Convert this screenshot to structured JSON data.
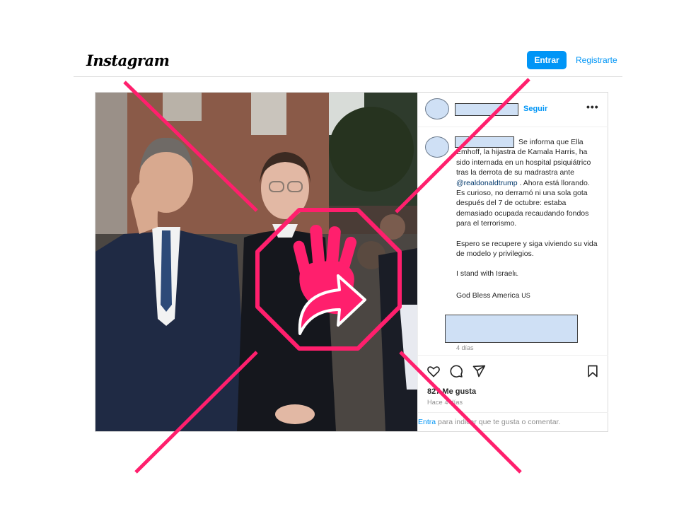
{
  "header": {
    "logo_text": "Instagram",
    "login_label": "Entrar",
    "signup_label": "Registrarte"
  },
  "post": {
    "follow_label": "Seguir",
    "more_label": "•••",
    "caption": {
      "p1": "Se informa que Ella Emhoff, la hijastra de Kamala Harris, ha sido internada en un hospital psiquiátrico tras la derrota de su madrastra ante",
      "mention": "@realdonaldtrump",
      "p1_end": ". Ahora está llorando. Es curioso, no derramó ni una sola gota después del 7 de octubre: estaba demasiado ocupada recaudando fondos para el terrorismo.",
      "p2": "Espero se recupere y siga viviendo su vida de modelo y privilegios.",
      "p3": "I stand with Israel",
      "p3_flag": "IL",
      "p4": "God Bless America",
      "p4_flag": "US"
    },
    "caption_time": "4 días",
    "likes": "827 Me gusta",
    "posted_ago": "Hace 4 días",
    "login_prompt_link": "Entra",
    "login_prompt_rest": " para indicar que te gusta o comentar."
  },
  "icons": {
    "like": "heart-icon",
    "comment": "comment-icon",
    "share": "send-icon",
    "save": "bookmark-icon"
  },
  "colors": {
    "accent": "#0095f6",
    "overlay": "#ff1f6d"
  }
}
